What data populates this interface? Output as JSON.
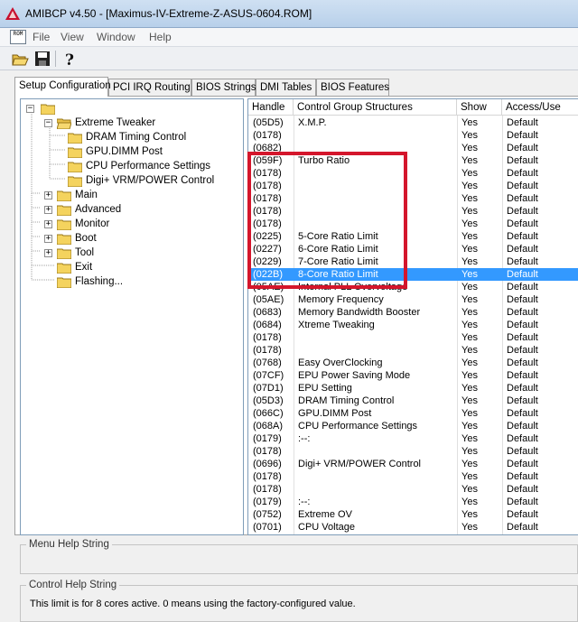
{
  "window": {
    "title": "AMIBCP v4.50 - [Maximus-IV-Extreme-Z-ASUS-0604.ROM]",
    "doc_icon_text": "ROM"
  },
  "menu": [
    {
      "label": "File",
      "name": "menu-file"
    },
    {
      "label": "View",
      "name": "menu-view"
    },
    {
      "label": "Window",
      "name": "menu-window"
    },
    {
      "label": "Help",
      "name": "menu-help"
    }
  ],
  "toolbar": {
    "open_icon": "open-folder-icon",
    "save_icon": "save-disk-icon",
    "help_icon": "help-question-icon",
    "help_glyph": "?"
  },
  "tabs": [
    {
      "label": "Setup Configuration",
      "name": "tab-setup-configuration",
      "active": true
    },
    {
      "label": "PCI IRQ Routing",
      "name": "tab-pci-irq-routing"
    },
    {
      "label": "BIOS Strings",
      "name": "tab-bios-strings"
    },
    {
      "label": "DMI Tables",
      "name": "tab-dmi-tables"
    },
    {
      "label": "BIOS Features",
      "name": "tab-bios-features"
    }
  ],
  "tree": {
    "expanded_glyph": "−",
    "collapsed_glyph": "+",
    "extreme_tweaker": {
      "label": "Extreme Tweaker",
      "children": [
        {
          "label": "DRAM Timing Control"
        },
        {
          "label": "GPU.DIMM Post"
        },
        {
          "label": "CPU Performance Settings"
        },
        {
          "label": "Digi+ VRM/POWER Control"
        }
      ]
    },
    "items": [
      {
        "label": "Main",
        "expandable": true
      },
      {
        "label": "Advanced",
        "expandable": true
      },
      {
        "label": "Monitor",
        "expandable": true
      },
      {
        "label": "Boot",
        "expandable": true
      },
      {
        "label": "Tool",
        "expandable": true
      },
      {
        "label": "Exit",
        "expandable": false
      },
      {
        "label": "Flashing...",
        "expandable": false
      }
    ]
  },
  "grid": {
    "headers": [
      "Handle",
      "Control Group Structures",
      "Show",
      "Access/Use"
    ],
    "selected_index": 13,
    "rows": [
      [
        "(05D5)",
        "X.M.P.",
        "Yes",
        "Default"
      ],
      [
        "(0178)",
        "",
        "Yes",
        "Default"
      ],
      [
        "(0682)",
        "",
        "Yes",
        "Default"
      ],
      [
        "(059F)",
        "Turbo Ratio",
        "Yes",
        "Default"
      ],
      [
        "(0178)",
        "",
        "Yes",
        "Default"
      ],
      [
        "(0178)",
        "",
        "Yes",
        "Default"
      ],
      [
        "(0178)",
        "",
        "Yes",
        "Default"
      ],
      [
        "(0178)",
        "",
        "Yes",
        "Default"
      ],
      [
        "(0178)",
        "",
        "Yes",
        "Default"
      ],
      [
        "(0225)",
        "5-Core Ratio Limit",
        "Yes",
        "Default"
      ],
      [
        "(0227)",
        "6-Core Ratio Limit",
        "Yes",
        "Default"
      ],
      [
        "(0229)",
        "7-Core Ratio Limit",
        "Yes",
        "Default"
      ],
      [
        "(022B)",
        "8-Core Ratio Limit",
        "Yes",
        "Default"
      ],
      [
        "(05AE)",
        "Internal PLL Overvoltage",
        "Yes",
        "Default"
      ],
      [
        "(05AE)",
        "Memory Frequency",
        "Yes",
        "Default"
      ],
      [
        "(0683)",
        "Memory Bandwidth Booster",
        "Yes",
        "Default"
      ],
      [
        "(0684)",
        "Xtreme Tweaking",
        "Yes",
        "Default"
      ],
      [
        "(0178)",
        "",
        "Yes",
        "Default"
      ],
      [
        "(0178)",
        "",
        "Yes",
        "Default"
      ],
      [
        "(0768)",
        "Easy OverClocking",
        "Yes",
        "Default"
      ],
      [
        "(07CF)",
        "EPU Power Saving Mode",
        "Yes",
        "Default"
      ],
      [
        "(07D1)",
        "EPU Setting",
        "Yes",
        "Default"
      ],
      [
        "(05D3)",
        "DRAM Timing Control",
        "Yes",
        "Default"
      ],
      [
        "(066C)",
        "GPU.DIMM Post",
        "Yes",
        "Default"
      ],
      [
        "(068A)",
        "CPU Performance Settings",
        "Yes",
        "Default"
      ],
      [
        "(0179)",
        ":--:",
        "Yes",
        "Default"
      ],
      [
        "(0178)",
        "",
        "Yes",
        "Default"
      ],
      [
        "(0696)",
        "Digi+ VRM/POWER Control",
        "Yes",
        "Default"
      ],
      [
        "(0178)",
        "",
        "Yes",
        "Default"
      ],
      [
        "(0178)",
        "",
        "Yes",
        "Default"
      ],
      [
        "(0179)",
        ":--:",
        "Yes",
        "Default"
      ],
      [
        "(0752)",
        "Extreme OV",
        "Yes",
        "Default"
      ],
      [
        "(0701)",
        "CPU Voltage",
        "Yes",
        "Default"
      ]
    ]
  },
  "menu_help": {
    "title": "Menu Help String",
    "text": ""
  },
  "control_help": {
    "title": "Control Help String",
    "text": "This limit is for 8 cores active.  0 means using the factory-configured value."
  },
  "colors": {
    "selection": "#3399ff",
    "highlight_box": "#d4162c",
    "folder": "#f4d35e"
  }
}
